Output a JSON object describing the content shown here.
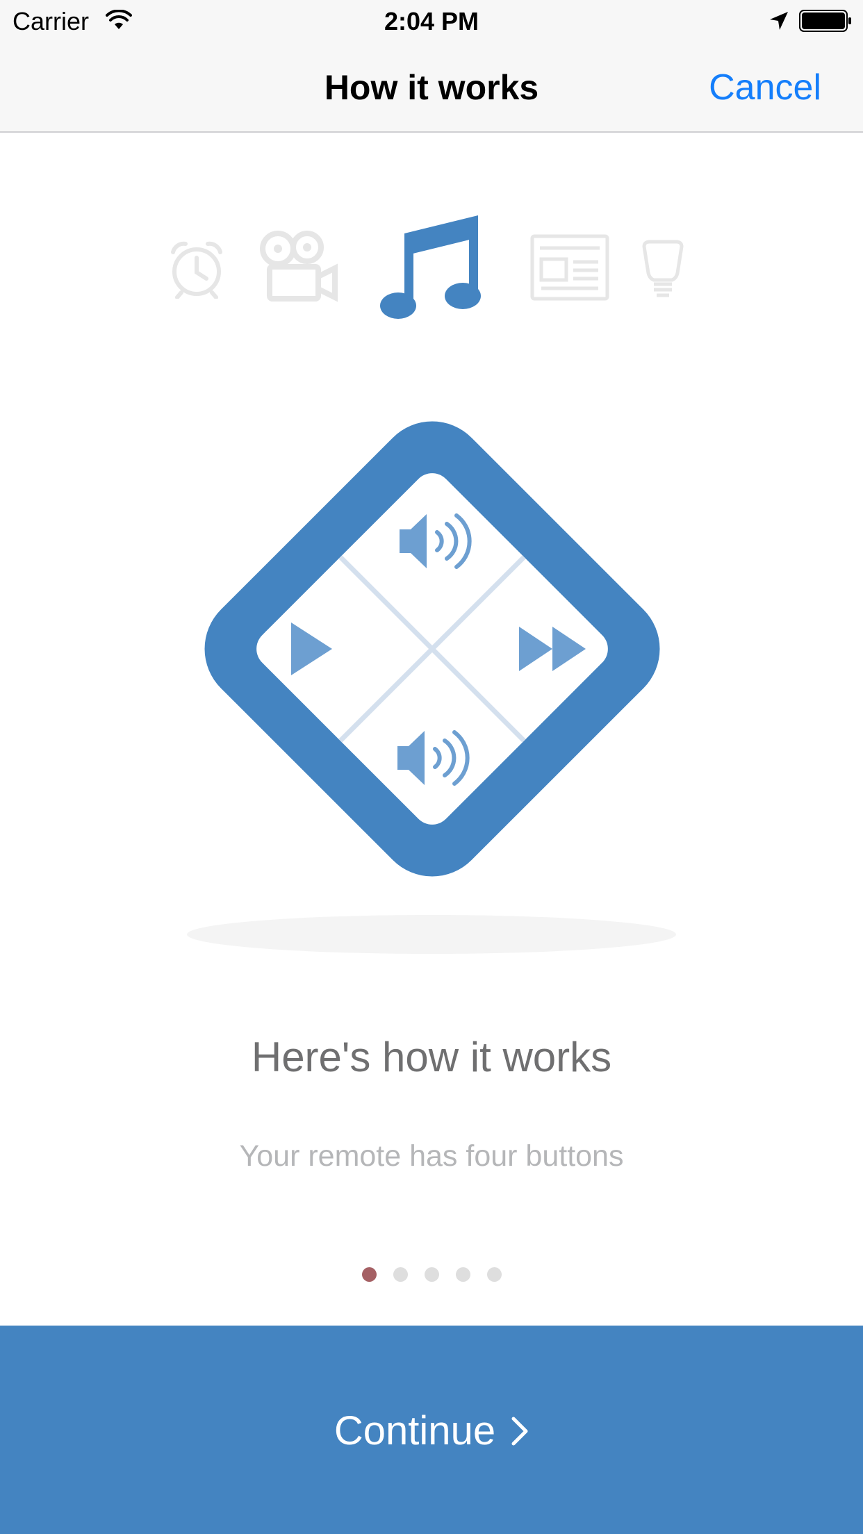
{
  "status_bar": {
    "carrier": "Carrier",
    "time": "2:04 PM",
    "icons": [
      "wifi-icon",
      "location-arrow-icon",
      "battery-icon"
    ]
  },
  "nav": {
    "title": "How it works",
    "cancel_label": "Cancel"
  },
  "category_icons": [
    {
      "name": "alarm-clock-icon",
      "active": false
    },
    {
      "name": "video-camera-icon",
      "active": false
    },
    {
      "name": "music-note-icon",
      "active": true
    },
    {
      "name": "news-icon",
      "active": false
    },
    {
      "name": "light-bulb-icon",
      "active": false
    }
  ],
  "remote": {
    "buttons": [
      "volume-up-icon",
      "play-icon",
      "fast-forward-icon",
      "volume-down-icon"
    ]
  },
  "content": {
    "headline": "Here's how it works",
    "subtitle": "Your remote has four buttons"
  },
  "pager": {
    "count": 5,
    "active_index": 0
  },
  "cta": {
    "label": "Continue"
  },
  "colors": {
    "brand_blue": "#4484c1",
    "ios_blue": "#147efb",
    "active_dot": "#a56064",
    "inactive_dot": "#dedede",
    "inactive_icon": "#e6e6e6"
  }
}
